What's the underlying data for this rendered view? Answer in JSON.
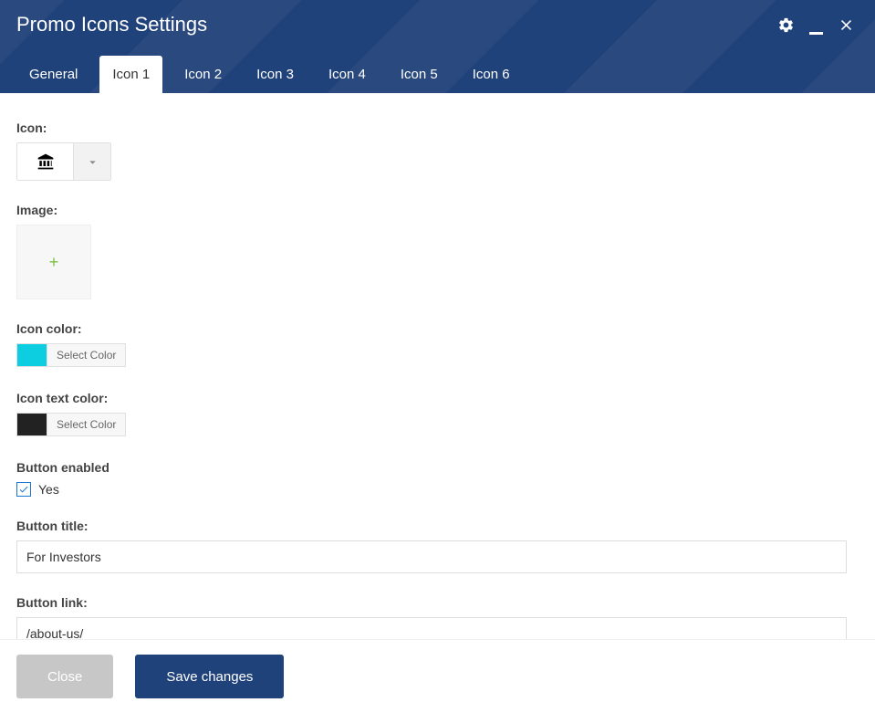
{
  "header": {
    "title": "Promo Icons Settings"
  },
  "tabs": {
    "general": "General",
    "icon1": "Icon 1",
    "icon2": "Icon 2",
    "icon3": "Icon 3",
    "icon4": "Icon 4",
    "icon5": "Icon 5",
    "icon6": "Icon 6"
  },
  "form": {
    "icon_label": "Icon:",
    "image_label": "Image:",
    "icon_color_label": "Icon color:",
    "icon_color_value": "#0dcde0",
    "select_color": "Select Color",
    "icon_text_color_label": "Icon text color:",
    "icon_text_color_value": "#222222",
    "button_enabled_label": "Button enabled",
    "yes_label": "Yes",
    "button_title_label": "Button title:",
    "button_title_value": "For Investors",
    "button_link_label": "Button link:",
    "button_link_value": "/about-us/"
  },
  "footer": {
    "close": "Close",
    "save": "Save changes"
  }
}
